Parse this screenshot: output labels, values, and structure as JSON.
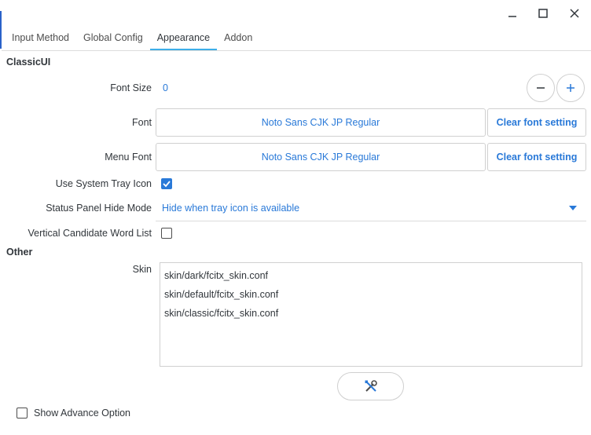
{
  "window": {
    "minimize_icon": "minimize-icon",
    "maximize_icon": "maximize-icon",
    "close_icon": "close-icon"
  },
  "tabs": [
    {
      "label": "Input Method"
    },
    {
      "label": "Global Config"
    },
    {
      "label": "Appearance",
      "active": true
    },
    {
      "label": "Addon"
    }
  ],
  "classicui": {
    "section_title": "ClassicUI",
    "font_size_label": "Font Size",
    "font_size_value": "0",
    "font_label": "Font",
    "font_value": "Noto Sans CJK JP Regular",
    "font_clear": "Clear font setting",
    "menu_font_label": "Menu Font",
    "menu_font_value": "Noto Sans CJK JP Regular",
    "menu_font_clear": "Clear font setting",
    "tray_label": "Use System Tray Icon",
    "tray_checked": true,
    "status_label": "Status Panel Hide Mode",
    "status_value": "Hide when tray icon is available",
    "vertical_label": "Vertical Candidate Word List",
    "vertical_checked": false
  },
  "other": {
    "section_title": "Other",
    "skin_label": "Skin",
    "skins": [
      "skin/dark/fcitx_skin.conf",
      "skin/default/fcitx_skin.conf",
      "skin/classic/fcitx_skin.conf"
    ],
    "configure_icon": "tools-icon"
  },
  "footer": {
    "advance_label": "Show Advance Option",
    "advance_checked": false
  },
  "colors": {
    "accent": "#2979d8",
    "tab_underline": "#3daee9"
  }
}
